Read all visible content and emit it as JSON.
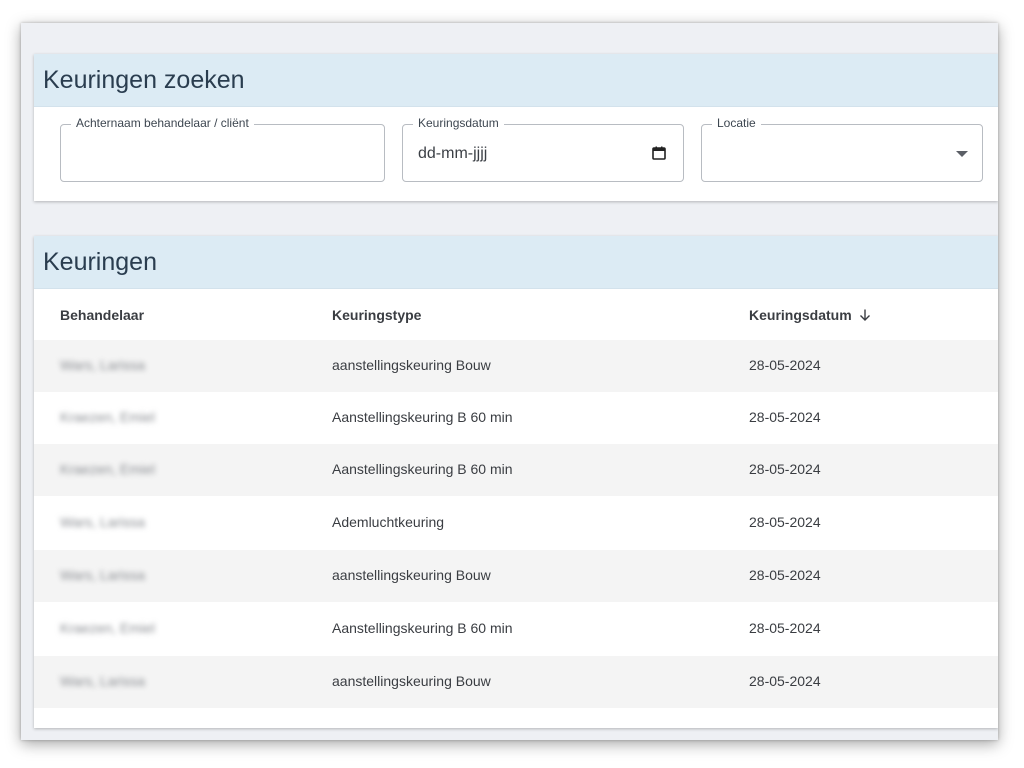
{
  "search": {
    "title": "Keuringen zoeken",
    "fields": {
      "name": {
        "label": "Achternaam behandelaar / cliënt",
        "value": ""
      },
      "date": {
        "label": "Keuringsdatum",
        "value": "dd-mm-jjjj"
      },
      "location": {
        "label": "Locatie",
        "value": ""
      }
    }
  },
  "table": {
    "title": "Keuringen",
    "columns": [
      "Behandelaar",
      "Keuringstype",
      "Keuringsdatum"
    ],
    "sort": {
      "column": "Keuringsdatum",
      "direction": "descending"
    },
    "rows": [
      {
        "behandelaar": "Wars, Larissa",
        "type": "aanstellingskeuring Bouw",
        "datum": "28-05-2024"
      },
      {
        "behandelaar": "Kraezen, Emiel",
        "type": "Aanstellingskeuring B 60 min",
        "datum": "28-05-2024"
      },
      {
        "behandelaar": "Kraezen, Emiel",
        "type": "Aanstellingskeuring B 60 min",
        "datum": "28-05-2024"
      },
      {
        "behandelaar": "Wars, Larissa",
        "type": "Ademluchtkeuring",
        "datum": "28-05-2024"
      },
      {
        "behandelaar": "Wars, Larissa",
        "type": "aanstellingskeuring Bouw",
        "datum": "28-05-2024"
      },
      {
        "behandelaar": "Kraezen, Emiel",
        "type": "Aanstellingskeuring B 60 min",
        "datum": "28-05-2024"
      },
      {
        "behandelaar": "Wars, Larissa",
        "type": "aanstellingskeuring Bouw",
        "datum": "28-05-2024"
      }
    ]
  },
  "colors": {
    "header_bg": "#dcebf4",
    "row_stripe": "#f4f4f4",
    "page_bg": "#eef0f4"
  },
  "icons": [
    "calendar-icon",
    "dropdown-caret-icon",
    "sort-descending-icon"
  ]
}
